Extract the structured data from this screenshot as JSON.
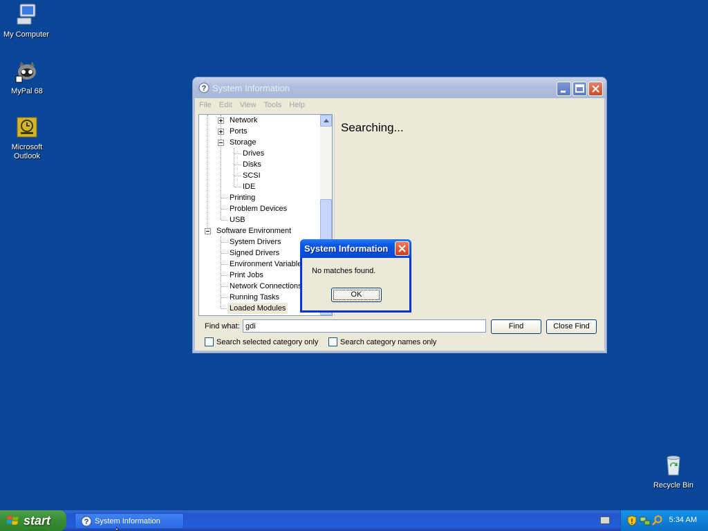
{
  "desktop": {
    "icons": [
      {
        "label": "My Computer"
      },
      {
        "label": "MyPal 68"
      },
      {
        "label": "Microsoft Outlook"
      },
      {
        "label": "Recycle Bin"
      }
    ]
  },
  "window": {
    "title": "System Information",
    "menu": [
      "File",
      "Edit",
      "View",
      "Tools",
      "Help"
    ],
    "tree": [
      {
        "label": "Network",
        "level": 2,
        "expander": "plus"
      },
      {
        "label": "Ports",
        "level": 2,
        "expander": "plus"
      },
      {
        "label": "Storage",
        "level": 2,
        "expander": "minus"
      },
      {
        "label": "Drives",
        "level": 3
      },
      {
        "label": "Disks",
        "level": 3
      },
      {
        "label": "SCSI",
        "level": 3
      },
      {
        "label": "IDE",
        "level": 3
      },
      {
        "label": "Printing",
        "level": 2
      },
      {
        "label": "Problem Devices",
        "level": 2
      },
      {
        "label": "USB",
        "level": 2
      },
      {
        "label": "Software Environment",
        "level": 1,
        "expander": "minus"
      },
      {
        "label": "System Drivers",
        "level": 2
      },
      {
        "label": "Signed Drivers",
        "level": 2
      },
      {
        "label": "Environment Variables",
        "level": 2
      },
      {
        "label": "Print Jobs",
        "level": 2
      },
      {
        "label": "Network Connections",
        "level": 2
      },
      {
        "label": "Running Tasks",
        "level": 2
      },
      {
        "label": "Loaded Modules",
        "level": 2,
        "selected": true
      }
    ],
    "status": "Searching...",
    "find": {
      "label": "Find what:",
      "value": "gdi",
      "find_button": "Find",
      "close_button": "Close Find",
      "opt_selected": "Search selected category only",
      "opt_names": "Search category names only"
    }
  },
  "dialog": {
    "title": "System Information",
    "message": "No matches found.",
    "ok": "OK"
  },
  "taskbar": {
    "start": "start",
    "task": "System Information",
    "clock": "5:34 AM"
  }
}
